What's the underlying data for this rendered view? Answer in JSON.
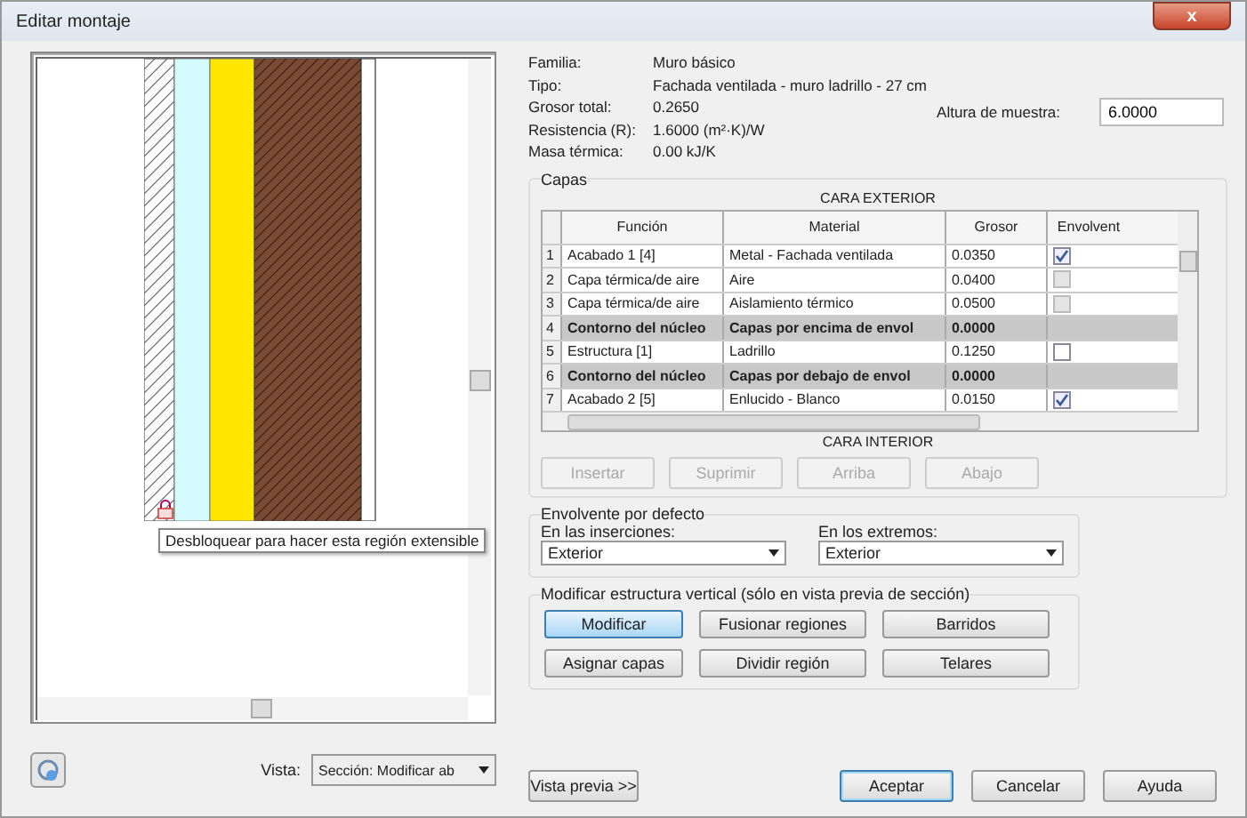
{
  "window": {
    "title": "Editar montaje",
    "close": "x"
  },
  "preview": {
    "tooltip": "Desbloquear para hacer esta región extensible",
    "view_label": "Vista:",
    "view_value": "Sección: Modificar ab",
    "preview_button": "Vista previa >>"
  },
  "properties": [
    {
      "label": "Familia:",
      "value": "Muro básico"
    },
    {
      "label": "Tipo:",
      "value": "Fachada ventilada - muro ladrillo - 27 cm"
    },
    {
      "label": "Grosor total:",
      "value": "0.2650"
    },
    {
      "label": "Resistencia (R):",
      "value": "1.6000 (m²·K)/W"
    },
    {
      "label": "Masa térmica:",
      "value": "0.00 kJ/K"
    }
  ],
  "sample_height": {
    "label": "Altura de muestra:",
    "value": "6.0000"
  },
  "layers": {
    "title": "Capas",
    "top_caption": "CARA EXTERIOR",
    "bottom_caption": "CARA INTERIOR",
    "columns": [
      "Función",
      "Material",
      "Grosor",
      "Envolvent"
    ],
    "rows": [
      {
        "index": "1",
        "kind": "layer",
        "function": "Acabado 1 [4]",
        "material": "Metal - Fachada ventilada",
        "thickness": "0.0350",
        "wrap": {
          "checked": true,
          "disabled": false
        }
      },
      {
        "index": "2",
        "kind": "layer",
        "function": "Capa térmica/de aire",
        "material": "Aire",
        "thickness": "0.0400",
        "wrap": {
          "checked": false,
          "disabled": true
        }
      },
      {
        "index": "3",
        "kind": "layer",
        "function": "Capa térmica/de aire",
        "material": "Aislamiento térmico",
        "thickness": "0.0500",
        "wrap": {
          "checked": false,
          "disabled": true
        }
      },
      {
        "index": "4",
        "kind": "core",
        "function": "Contorno del núcleo",
        "material": "Capas por encima de envol",
        "thickness": "0.0000"
      },
      {
        "index": "5",
        "kind": "layer",
        "function": "Estructura [1]",
        "material": "Ladrillo",
        "thickness": "0.1250",
        "wrap": {
          "checked": false,
          "disabled": false
        }
      },
      {
        "index": "6",
        "kind": "core",
        "function": "Contorno del núcleo",
        "material": "Capas por debajo de envol",
        "thickness": "0.0000"
      },
      {
        "index": "7",
        "kind": "layer",
        "function": "Acabado 2 [5]",
        "material": "Enlucido - Blanco",
        "thickness": "0.0150",
        "wrap": {
          "checked": true,
          "disabled": false
        }
      }
    ],
    "buttons": [
      {
        "label": "Insertar",
        "disabled": true
      },
      {
        "label": "Suprimir",
        "disabled": true
      },
      {
        "label": "Arriba",
        "disabled": true
      },
      {
        "label": "Abajo",
        "disabled": true
      }
    ]
  },
  "default_wrapping": {
    "title": "Envolvente por defecto",
    "fields": [
      {
        "label": "En las inserciones:",
        "value": "Exterior"
      },
      {
        "label": "En los extremos:",
        "value": "Exterior"
      }
    ]
  },
  "vertical": {
    "title": "Modificar estructura vertical (sólo en vista previa de sección)",
    "buttons": [
      {
        "label": "Modificar",
        "selected": true
      },
      {
        "label": "Fusionar regiones",
        "selected": false
      },
      {
        "label": "Barridos",
        "selected": false
      },
      {
        "label": "Asignar capas",
        "selected": false
      },
      {
        "label": "Dividir región",
        "selected": false
      },
      {
        "label": "Telares",
        "selected": false
      }
    ]
  },
  "footer_buttons": [
    {
      "label": "Aceptar",
      "default": true
    },
    {
      "label": "Cancelar",
      "default": false
    },
    {
      "label": "Ayuda",
      "default": false
    }
  ]
}
